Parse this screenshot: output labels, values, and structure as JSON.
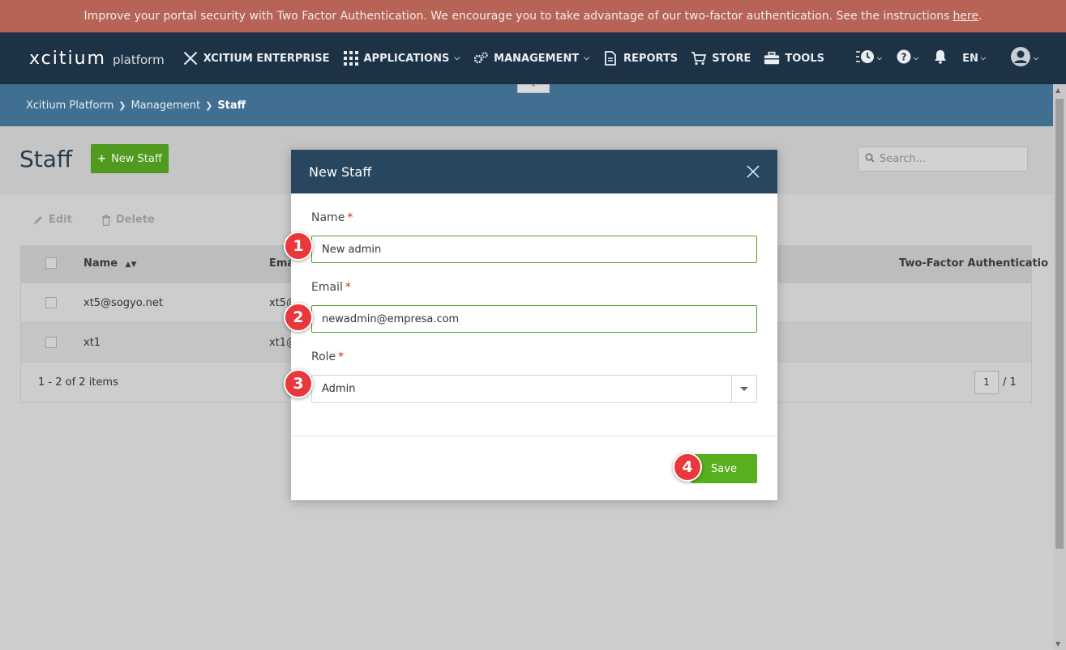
{
  "banner": {
    "text": "Improve your portal security with Two Factor Authentication. We encourage you to take advantage of our two-factor authentication. See the instructions",
    "link": "here",
    "end": "."
  },
  "navbar": {
    "brand": "xcitium",
    "brand_sub": "platform",
    "items": [
      {
        "label": "XCITIUM ENTERPRISE",
        "icon": "xcitium-logo-icon"
      },
      {
        "label": "APPLICATIONS",
        "icon": "grid-icon",
        "dropdown": true
      },
      {
        "label": "MANAGEMENT",
        "icon": "gears-icon",
        "dropdown": true
      },
      {
        "label": "REPORTS",
        "icon": "document-icon"
      },
      {
        "label": "STORE",
        "icon": "cart-icon"
      },
      {
        "label": "TOOLS",
        "icon": "toolbox-icon"
      }
    ],
    "language": "EN"
  },
  "breadcrumb": [
    "Xcitium Platform",
    "Management",
    "Staff"
  ],
  "page": {
    "title": "Staff",
    "new_button": "New Staff",
    "search_placeholder": "Search...",
    "actions": {
      "edit": "Edit",
      "delete": "Delete"
    }
  },
  "grid": {
    "headers": {
      "name": "Name",
      "email": "Ema",
      "two_factor": "Two-Factor Authenticatio"
    },
    "rows": [
      {
        "name": "xt5@sogyo.net",
        "email": "xt5@"
      },
      {
        "name": "xt1",
        "email": "xt1@"
      }
    ],
    "summary": "1 - 2 of 2 items",
    "page": "1",
    "page_total": "/ 1"
  },
  "modal": {
    "title": "New Staff",
    "name_label": "Name",
    "name_value": "New admin",
    "email_label": "Email",
    "email_value": "newadmin@empresa.com",
    "role_label": "Role",
    "role_value": "Admin",
    "required_mark": "*",
    "save_button": "Save"
  },
  "steps": [
    "1",
    "2",
    "3",
    "4"
  ],
  "colors": {
    "banner": "#b76355",
    "navbar": "#1e3246",
    "breadcrumb": "#416f92",
    "modal_header": "#284660",
    "accent_green": "#58b01f",
    "step_marker": "#e8383b"
  }
}
